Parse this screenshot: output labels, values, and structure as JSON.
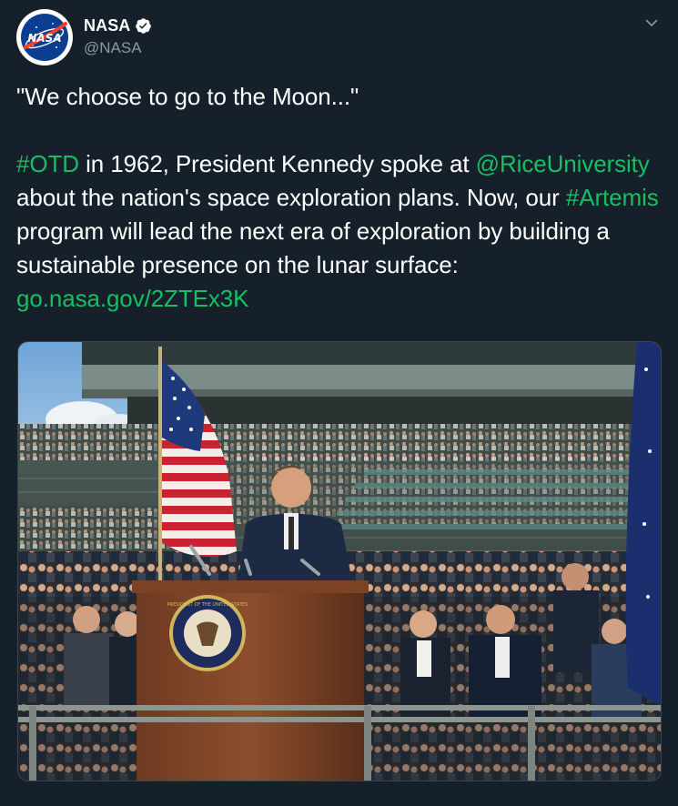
{
  "account": {
    "display_name": "NASA",
    "handle": "@NASA",
    "verified": true,
    "avatar_text": "NASA"
  },
  "tweet": {
    "line1": "\"We choose to go to the Moon...\"",
    "p2_hashtag_otd": "#OTD",
    "p2_text_a": " in 1962, President Kennedy spoke at ",
    "p2_mention": "@RiceUniversity",
    "p2_text_b": " about the nation's space exploration plans. Now, our ",
    "p2_hashtag_artemis": "#Artemis",
    "p2_text_c": " program will lead the next era of exploration by building a sustainable presence on the lunar surface: ",
    "p2_link": "go.nasa.gov/2ZTEx3K"
  },
  "media": {
    "seal_text": "PRESIDENT OF THE UNITED STATES"
  },
  "colors": {
    "background": "#15202b",
    "link": "#17bf63",
    "secondary_text": "#8899a6",
    "verified_badge": "#ffffff"
  },
  "icons": {
    "verified": "verified-badge-icon",
    "menu": "chevron-down-icon"
  }
}
